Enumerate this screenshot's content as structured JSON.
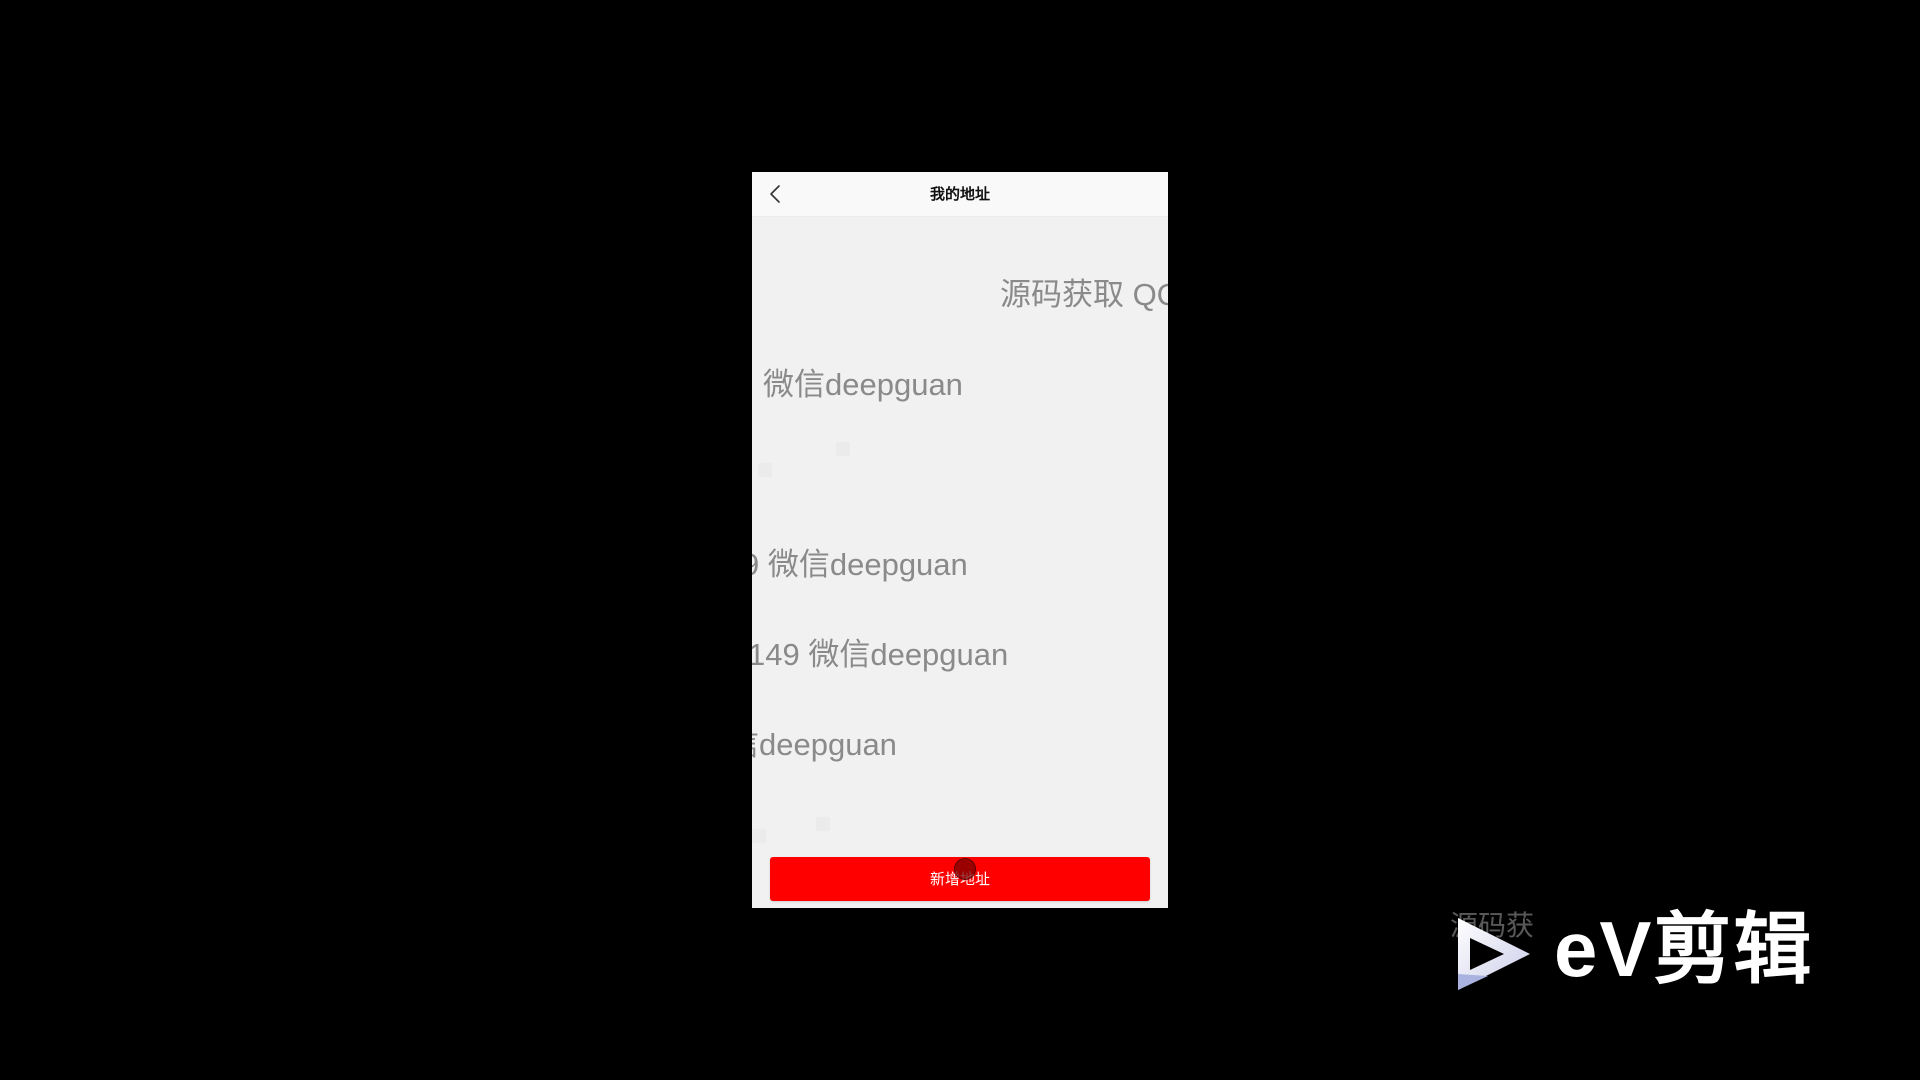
{
  "nav": {
    "title": "我的地址",
    "back_icon": "chevron-left-icon"
  },
  "watermarks": [
    "源码获取 QQ",
    "微信deepguan",
    "9 微信deepguan",
    "149 微信deepguan",
    "信deepguan"
  ],
  "actions": {
    "add_address_label": "新增地址"
  },
  "overlay": {
    "brand_text": "eV剪辑",
    "ghost_text": "源码获",
    "brand_icon": "play-triangle-icon"
  },
  "colors": {
    "primary_button": "#fe0000",
    "page_background": "#f1f1f1",
    "nav_background": "#f9f9f9",
    "outer_background": "#000000",
    "watermark_text": "#8a8a8a"
  }
}
